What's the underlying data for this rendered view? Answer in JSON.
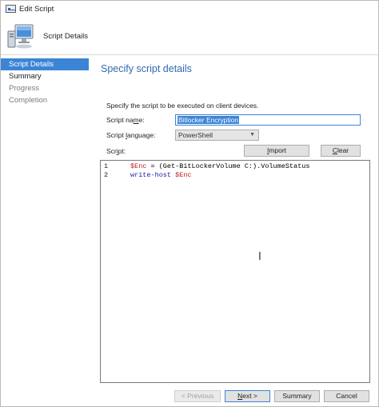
{
  "window": {
    "title": "Edit Script"
  },
  "header": {
    "title": "Script Details"
  },
  "nav": {
    "items": [
      {
        "label": "Script Details",
        "state": "active"
      },
      {
        "label": "Summary",
        "state": "normal"
      },
      {
        "label": "Progress",
        "state": "muted"
      },
      {
        "label": "Completion",
        "state": "muted"
      }
    ]
  },
  "content": {
    "title": "Specify script details",
    "description": "Specify the script to be executed on client devices.",
    "script_name": {
      "label_pre": "Script na",
      "label_access": "m",
      "label_post": "e:",
      "value": "Bitlocker Encryption"
    },
    "script_language": {
      "label_pre": "Script ",
      "label_access": "l",
      "label_post": "anguage:",
      "value": "PowerShell"
    },
    "script": {
      "label_pre": "Scr",
      "label_access": "i",
      "label_post": "pt:"
    },
    "import_button": {
      "label_access": "I",
      "label_post": "mport"
    },
    "clear_button": {
      "label_access": "C",
      "label_post": "lear"
    },
    "code": [
      {
        "line": "1",
        "parts": [
          {
            "t": "$Enc",
            "c": "var"
          },
          {
            "t": " = (Get-BitLockerVolume C:).VolumeStatus",
            "c": ""
          }
        ]
      },
      {
        "line": "2",
        "parts": [
          {
            "t": "write-host",
            "c": "kw"
          },
          {
            "t": " ",
            "c": ""
          },
          {
            "t": "$Enc",
            "c": "var"
          }
        ]
      }
    ]
  },
  "footer": {
    "previous": "< Previous",
    "next_pre": "",
    "next_access": "N",
    "next_post": "ext >",
    "summary": "Summary",
    "cancel": "Cancel"
  }
}
